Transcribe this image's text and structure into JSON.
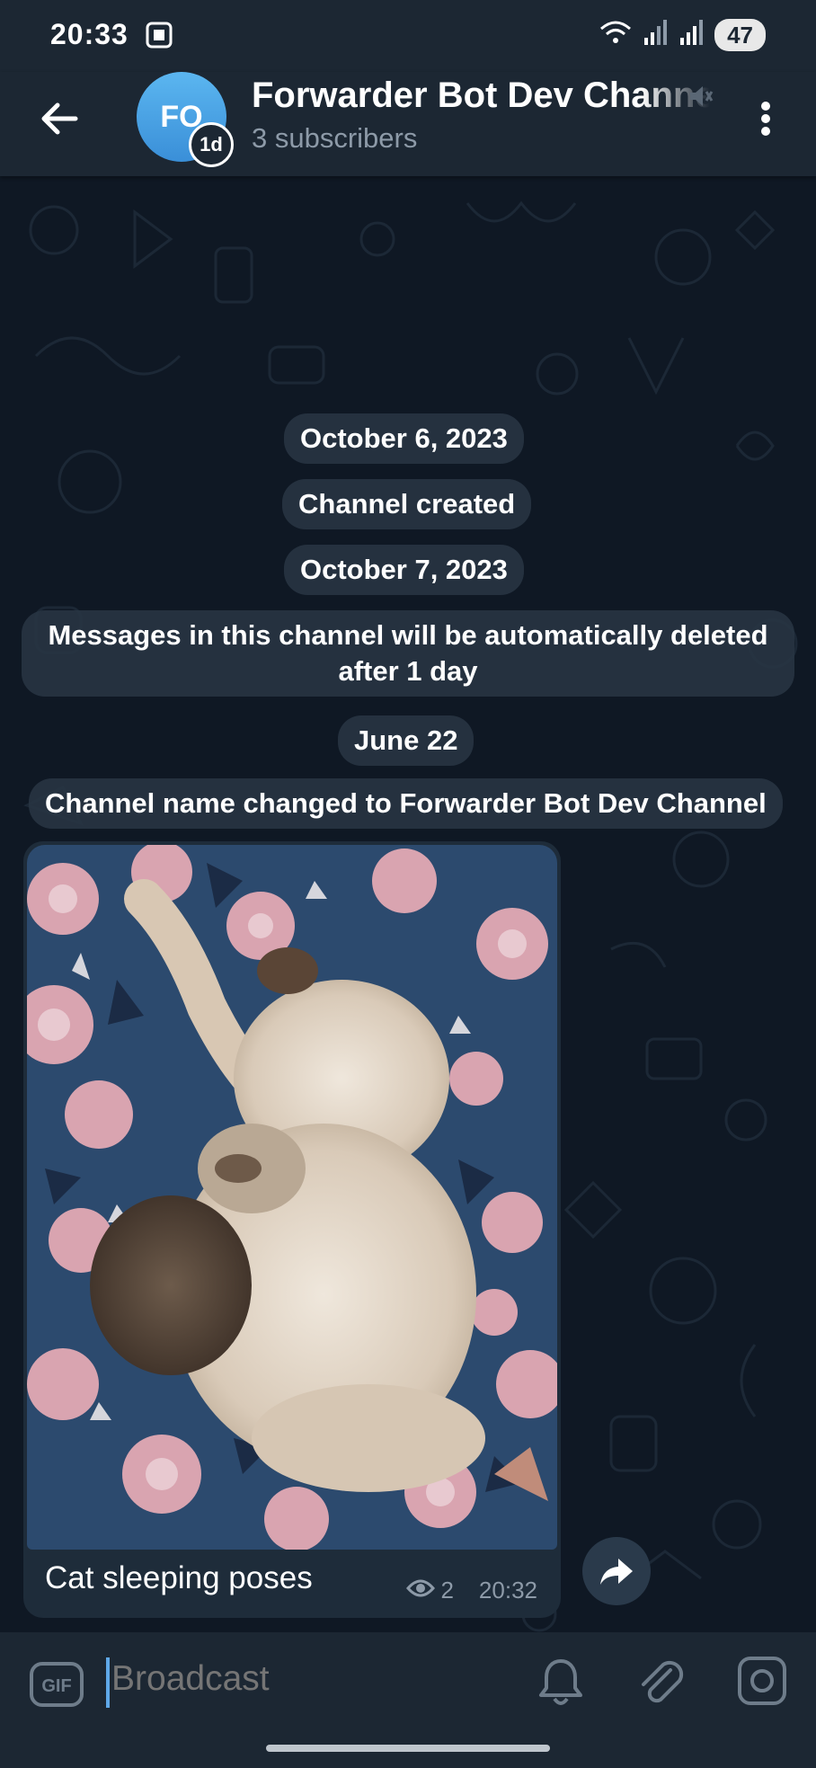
{
  "status_bar": {
    "time": "20:33",
    "battery": "47",
    "icons": [
      "screen-record-icon",
      "wifi-icon",
      "signal-icon",
      "signal-icon",
      "battery-icon"
    ]
  },
  "header": {
    "avatar_initials": "FO",
    "timer_badge": "1d",
    "title": "Forwarder Bot Dev Channel",
    "subtitle": "3 subscribers",
    "icons": [
      "back-arrow-icon",
      "mute-icon",
      "more-vert-icon"
    ]
  },
  "service_messages": [
    "October 6, 2023",
    "Channel created",
    "October 7, 2023",
    "Messages in this channel will be automatically deleted after 1 day",
    "June 22",
    "Channel name changed to Forwarder Bot Dev Channel"
  ],
  "message": {
    "caption": "Cat sleeping poses",
    "views": "2",
    "time": "20:32",
    "icons": [
      "eye-icon",
      "forward-icon"
    ]
  },
  "composer": {
    "placeholder": "Broadcast",
    "icons": [
      "gif-icon",
      "bell-icon",
      "paperclip-icon",
      "camera-icon"
    ]
  },
  "colors": {
    "header_bg": "#1c2733",
    "chat_bg": "#0f1824",
    "bubble_bg": "#1e2c3a",
    "pill_bg": "#273442",
    "accent": "#5fa8e8",
    "secondary_text": "#8d9aa8"
  }
}
